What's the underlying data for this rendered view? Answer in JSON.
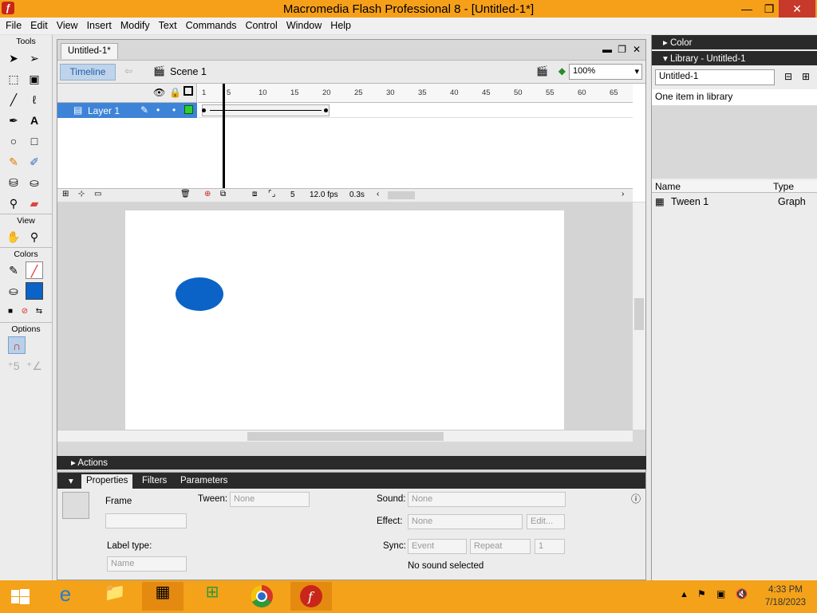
{
  "window": {
    "title": "Macromedia Flash Professional 8 - [Untitled-1*]",
    "min": "—",
    "max": "❐",
    "close": "✕",
    "app_icon": "ƒ"
  },
  "menu": [
    "File",
    "Edit",
    "View",
    "Insert",
    "Modify",
    "Text",
    "Commands",
    "Control",
    "Window",
    "Help"
  ],
  "tools": {
    "title": "Tools",
    "view": "View",
    "colors": "Colors",
    "options": "Options"
  },
  "document": {
    "tab": "Untitled-1*",
    "timeline_button": "Timeline",
    "scene": "Scene 1",
    "zoom": "100%",
    "layer_name": "Layer 1",
    "ruler_ticks": [
      "1",
      "5",
      "10",
      "15",
      "20",
      "25",
      "30",
      "35",
      "40",
      "45",
      "50",
      "55",
      "60",
      "65"
    ],
    "current_frame": "5",
    "fps": "12.0 fps",
    "elapsed": "0.3s"
  },
  "actions": {
    "label": "Actions"
  },
  "properties": {
    "tabs": [
      "Properties",
      "Filters",
      "Parameters"
    ],
    "frame_label": "Frame",
    "label_type": "Label type:",
    "label_type_value": "Name",
    "tween_label": "Tween:",
    "tween_value": "None",
    "sound_label": "Sound:",
    "sound_value": "None",
    "effect_label": "Effect:",
    "effect_value": "None",
    "edit_button": "Edit...",
    "sync_label": "Sync:",
    "sync_value": "Event",
    "repeat_value": "Repeat",
    "repeat_count": "1",
    "no_sound": "No sound selected"
  },
  "panels": {
    "color": "Color",
    "library": "Library - Untitled-1",
    "library_doc": "Untitled-1",
    "item_count": "One item in library",
    "col_name": "Name",
    "col_type": "Type",
    "item_name": "Tween 1",
    "item_type": "Graph"
  },
  "clock": {
    "time": "4:33 PM",
    "date": "7/18/2023"
  },
  "colors": {
    "fill": "#0b63c7",
    "accent": "#3d84d8"
  }
}
